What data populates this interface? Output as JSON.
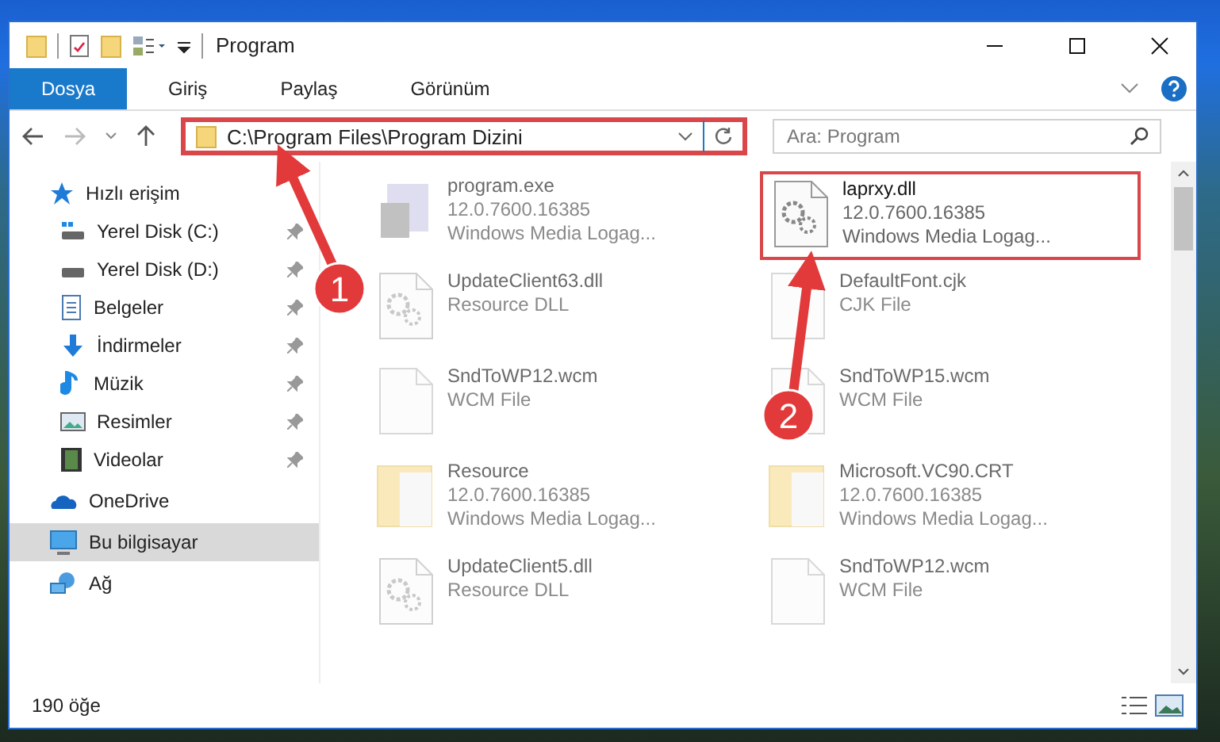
{
  "window": {
    "title": "Program"
  },
  "ribbon_tabs": [
    {
      "label": "Dosya",
      "selected": true
    },
    {
      "label": "Giriş",
      "selected": false
    },
    {
      "label": "Paylaş",
      "selected": false
    },
    {
      "label": "Görünüm",
      "selected": false
    }
  ],
  "address": {
    "value": "C:\\Program Files\\Program Dizini",
    "highlighted": true
  },
  "search": {
    "placeholder": "Ara: Program"
  },
  "sidebar": {
    "items": [
      {
        "label": "Hızlı erişim",
        "kind": "star",
        "selected": false,
        "children": [
          {
            "label": "Yerel Disk (C:)",
            "kind": "drive-c",
            "pinned": true
          },
          {
            "label": "Yerel Disk (D:)",
            "kind": "drive",
            "pinned": true
          },
          {
            "label": "Belgeler",
            "kind": "docs",
            "pinned": true
          },
          {
            "label": "İndirmeler",
            "kind": "download",
            "pinned": true
          },
          {
            "label": "Müzik",
            "kind": "music",
            "pinned": true
          },
          {
            "label": "Resimler",
            "kind": "pictures",
            "pinned": true
          },
          {
            "label": "Videolar",
            "kind": "video",
            "pinned": true
          }
        ]
      },
      {
        "label": "OneDrive",
        "kind": "cloud",
        "selected": false
      },
      {
        "label": "Bu bilgisayar",
        "kind": "pc",
        "selected": true
      },
      {
        "label": "Ağ",
        "kind": "network",
        "selected": false
      }
    ]
  },
  "files": [
    {
      "name": "program.exe",
      "kind": "exe",
      "details": [
        "12.0.7600.16385",
        "Windows Media Logag..."
      ],
      "dimmed": true,
      "highlighted": false
    },
    {
      "name": "laprxy.dll",
      "kind": "dll",
      "details": [
        "12.0.7600.16385",
        "Windows Media Logag..."
      ],
      "dimmed": false,
      "highlighted": true
    },
    {
      "name": "UpdateClient63.dll",
      "kind": "dll",
      "details": [
        "Resource DLL"
      ],
      "dimmed": true,
      "highlighted": false
    },
    {
      "name": "DefaultFont.cjk",
      "kind": "file",
      "details": [
        "CJK File"
      ],
      "dimmed": true,
      "highlighted": false
    },
    {
      "name": "SndToWP12.wcm",
      "kind": "file",
      "details": [
        "WCM File"
      ],
      "dimmed": true,
      "highlighted": false
    },
    {
      "name": "SndToWP15.wcm",
      "kind": "file",
      "details": [
        "WCM File"
      ],
      "dimmed": true,
      "highlighted": false
    },
    {
      "name": "Resource",
      "kind": "folder",
      "details": [
        "12.0.7600.16385",
        "Windows Media Logag..."
      ],
      "dimmed": true,
      "highlighted": false
    },
    {
      "name": "Microsoft.VC90.CRT",
      "kind": "folder",
      "details": [
        "12.0.7600.16385",
        "Windows Media Logag..."
      ],
      "dimmed": true,
      "highlighted": false
    },
    {
      "name": "UpdateClient5.dll",
      "kind": "dll",
      "details": [
        "Resource DLL"
      ],
      "dimmed": true,
      "highlighted": false
    },
    {
      "name": "SndToWP12.wcm",
      "kind": "file",
      "details": [
        "WCM File"
      ],
      "dimmed": true,
      "highlighted": false
    }
  ],
  "status_bar": {
    "count": "190 öğe"
  },
  "annotations": [
    {
      "number": "1"
    },
    {
      "number": "2"
    }
  ]
}
